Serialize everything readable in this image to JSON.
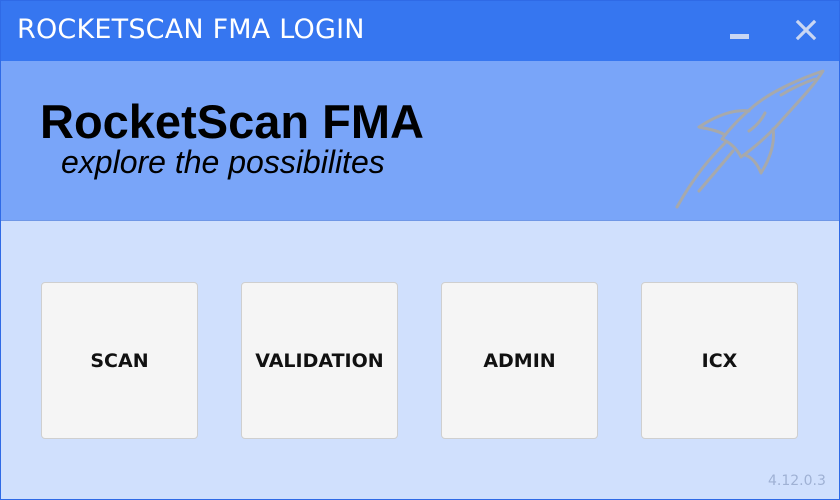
{
  "window": {
    "title": "ROCKETSCAN FMA LOGIN"
  },
  "banner": {
    "brand_name": "RocketScan FMA",
    "tagline": "explore the possibilites",
    "logo_icon": "rocket-icon"
  },
  "tiles": [
    {
      "label": "SCAN"
    },
    {
      "label": "VALIDATION"
    },
    {
      "label": "ADMIN"
    },
    {
      "label": "ICX"
    }
  ],
  "footer": {
    "version": "4.12.0.3"
  },
  "colors": {
    "titlebar": "#3676f0",
    "banner": "#79a5f9",
    "body": "#d0e0fd",
    "tile": "#f5f5f5"
  }
}
